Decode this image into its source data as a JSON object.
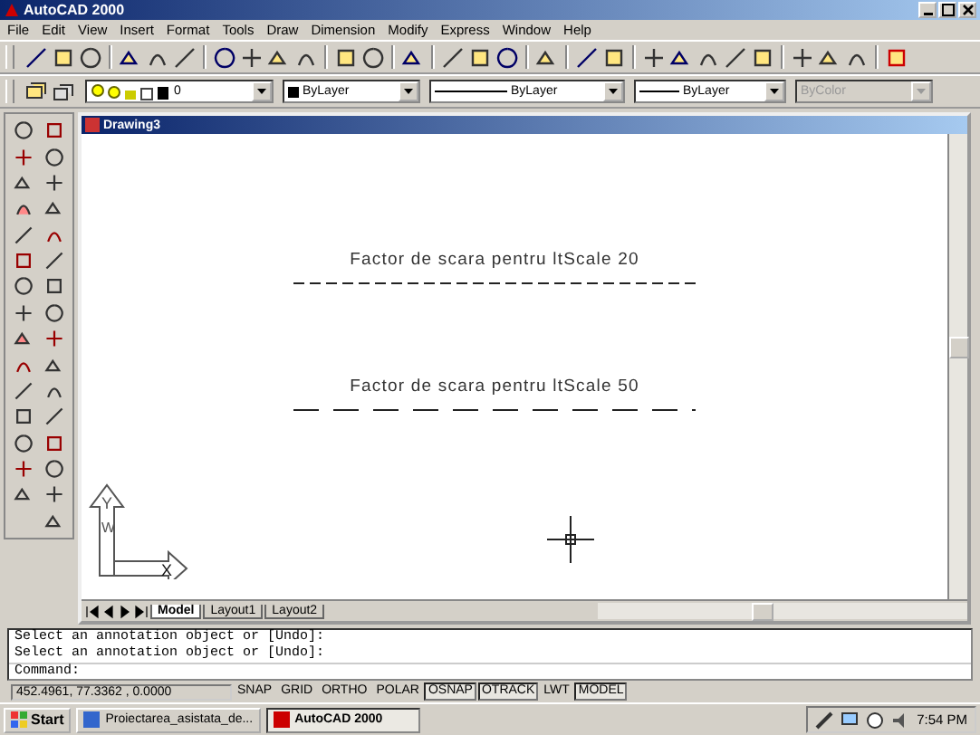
{
  "window": {
    "title": "AutoCAD 2000"
  },
  "menu": [
    "File",
    "Edit",
    "View",
    "Insert",
    "Format",
    "Tools",
    "Draw",
    "Dimension",
    "Modify",
    "Express",
    "Window",
    "Help"
  ],
  "properties_bar": [
    {
      "kind": "layer",
      "value": "0",
      "disabled": false
    },
    {
      "kind": "color",
      "value": "ByLayer",
      "disabled": false
    },
    {
      "kind": "linetype",
      "value": "ByLayer",
      "disabled": false
    },
    {
      "kind": "lineweight",
      "value": "ByLayer",
      "disabled": false
    },
    {
      "kind": "plotstyle",
      "value": "ByColor",
      "disabled": true
    }
  ],
  "drawing_window": {
    "title": "Drawing3",
    "texts": [
      {
        "text": "Factor de scara pentru ltScale 20",
        "kind": "fine"
      },
      {
        "text": "Factor de scara pentru ltScale 50",
        "kind": "coarse"
      }
    ],
    "ucs": {
      "y": "Y",
      "w": "W",
      "x": "X"
    },
    "tabs": [
      {
        "label": "Model",
        "selected": true
      },
      {
        "label": "Layout1",
        "selected": false
      },
      {
        "label": "Layout2",
        "selected": false
      }
    ]
  },
  "command_history": [
    "Select an annotation object or [Undo]:",
    "Select an annotation object or [Undo]:"
  ],
  "command_prompt": "Command:",
  "status_bar": {
    "coordinates": "452.4961, 77.3362 , 0.0000",
    "toggles": [
      {
        "label": "SNAP",
        "on": false
      },
      {
        "label": "GRID",
        "on": false
      },
      {
        "label": "ORTHO",
        "on": false
      },
      {
        "label": "POLAR",
        "on": false
      },
      {
        "label": "OSNAP",
        "on": true
      },
      {
        "label": "OTRACK",
        "on": true
      },
      {
        "label": "LWT",
        "on": false
      },
      {
        "label": "MODEL",
        "on": true
      }
    ]
  },
  "taskbar": {
    "start": "Start",
    "tasks": [
      {
        "label": "Proiectarea_asistata_de...",
        "selected": false
      },
      {
        "label": "AutoCAD 2000",
        "selected": true
      }
    ],
    "clock": "7:54 PM"
  }
}
